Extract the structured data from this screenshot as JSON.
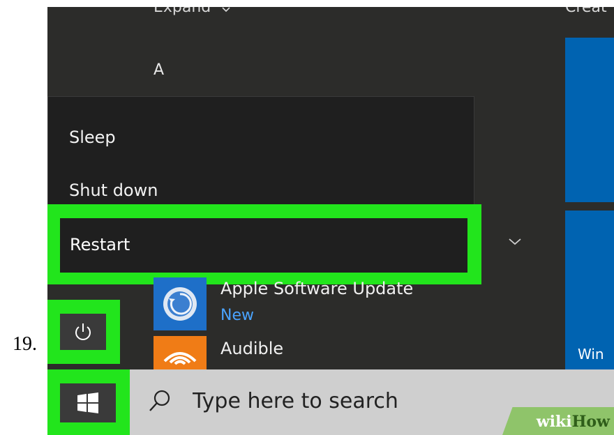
{
  "annotation": {
    "step_number": "19."
  },
  "start_menu": {
    "top_left_label": "Expand",
    "top_right_label": "Creat",
    "section_letter": "A",
    "tile": {
      "label": "Win"
    }
  },
  "power_menu": {
    "items": [
      {
        "label": "Sleep"
      },
      {
        "label": "Shut down"
      },
      {
        "label": "Restart"
      }
    ]
  },
  "apps": [
    {
      "name": "Apple Software Update",
      "badge": "New",
      "icon": "apple-software-update-icon"
    },
    {
      "name": "Audible",
      "icon": "audible-icon"
    }
  ],
  "taskbar": {
    "search_placeholder": "Type here to search"
  },
  "watermark": {
    "part1": "wiki",
    "part2": "How"
  },
  "colors": {
    "highlight": "#22e51c",
    "tile_blue": "#0063b1",
    "accent_text": "#4aa3ff",
    "taskbar": "#cfcfcf"
  }
}
